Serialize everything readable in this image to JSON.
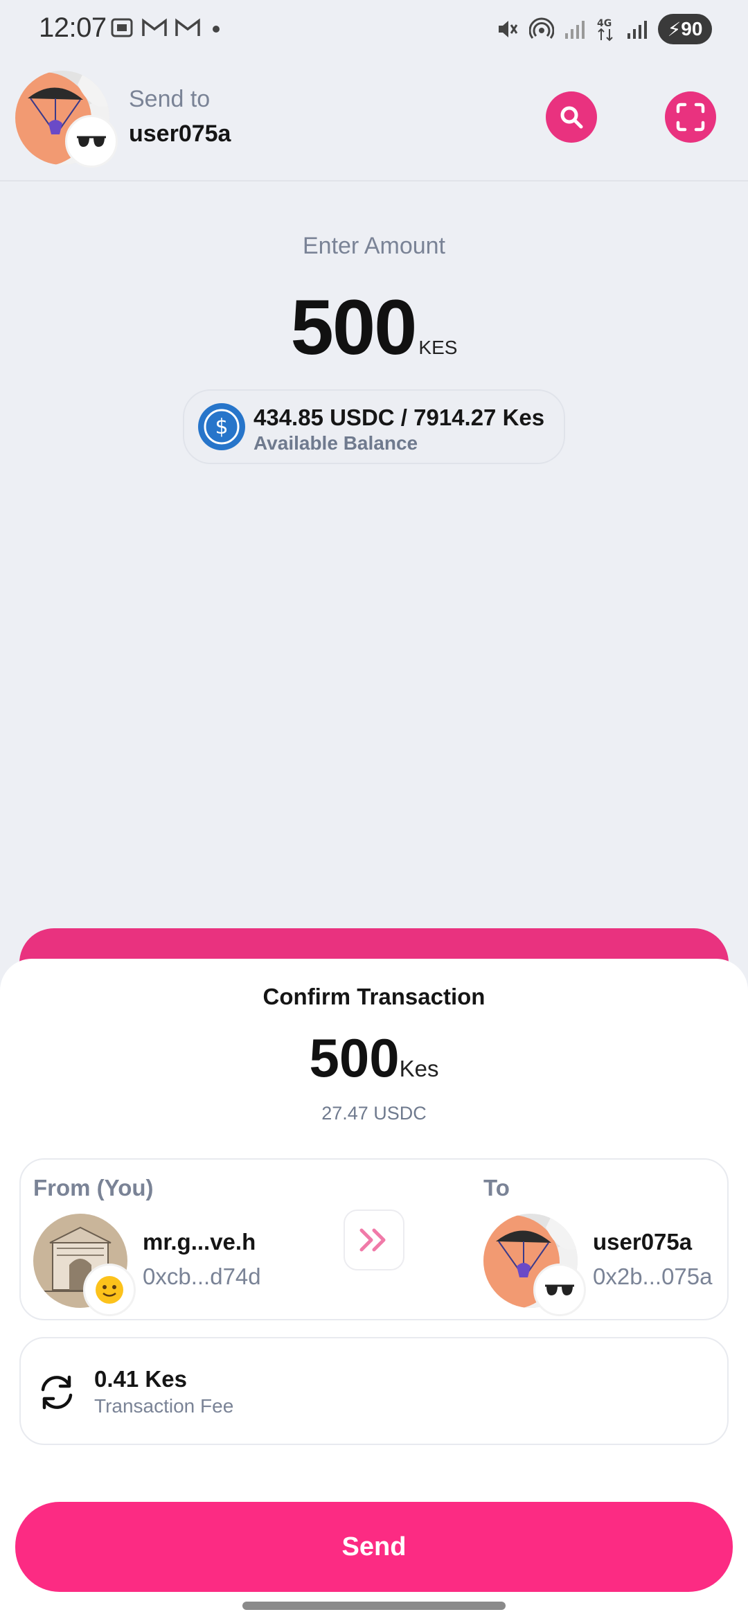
{
  "status_bar": {
    "time": "12:07",
    "battery": "90",
    "network": "4G"
  },
  "header": {
    "send_to_label": "Send to",
    "recipient_username": "user075a",
    "search_icon": "search-icon",
    "scan_icon": "scan-icon"
  },
  "amount": {
    "label": "Enter Amount",
    "value": "500",
    "currency": "KES"
  },
  "balance": {
    "icon": "usdc-icon",
    "text": "434.85 USDC / 7914.27 Kes",
    "label": "Available Balance"
  },
  "confirm": {
    "title": "Confirm Transaction",
    "amount": "500",
    "currency": "Kes",
    "usdc_equivalent": "27.47 USDC",
    "from": {
      "label": "From (You)",
      "name": "mr.g...ve.h",
      "address": "0xcb...d74d"
    },
    "to": {
      "label": "To",
      "name": "user075a",
      "address": "0x2b...075a"
    },
    "fee": {
      "amount": "0.41 Kes",
      "label": "Transaction Fee"
    },
    "send_label": "Send"
  },
  "colors": {
    "accent": "#fc2b83",
    "header_button": "#e9327f",
    "usdc_blue": "#2775ca",
    "muted_text": "#7a8396",
    "background": "#edeff4"
  }
}
